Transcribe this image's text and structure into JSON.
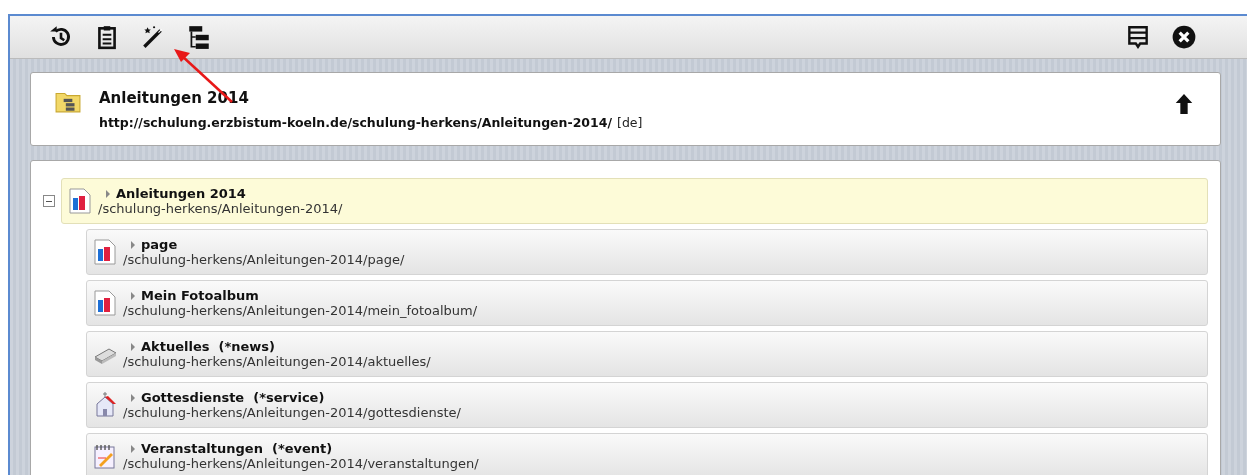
{
  "toolbar": {
    "left": [
      {
        "kind": "history"
      },
      {
        "kind": "clipboard"
      },
      {
        "kind": "wand"
      },
      {
        "kind": "tree"
      }
    ],
    "right": [
      {
        "kind": "list"
      },
      {
        "kind": "close"
      }
    ]
  },
  "header": {
    "title": "Anleitungen 2014",
    "url": "http://schulung.erzbistum-koeln.de/schulung-herkens/Anleitungen-2014/",
    "lang": "[de]"
  },
  "tree": {
    "name": "Anleitungen 2014",
    "path": "/schulung-herkens/Anleitungen-2014/",
    "kind": "page",
    "selected": true,
    "expanded": true,
    "children": [
      {
        "name": "page",
        "path": "/schulung-herkens/Anleitungen-2014/page/",
        "kind": "page",
        "selected": false
      },
      {
        "name": "Mein Fotoalbum",
        "path": "/schulung-herkens/Anleitungen-2014/mein_fotoalbum/",
        "kind": "page",
        "selected": false
      },
      {
        "name": "Aktuelles  (*news)",
        "path": "/schulung-herkens/Anleitungen-2014/aktuelles/",
        "kind": "news",
        "selected": false
      },
      {
        "name": "Gottesdienste  (*service)",
        "path": "/schulung-herkens/Anleitungen-2014/gottesdienste/",
        "kind": "service",
        "selected": false
      },
      {
        "name": "Veranstaltungen  (*event)",
        "path": "/schulung-herkens/Anleitungen-2014/veranstaltungen/",
        "kind": "event",
        "selected": false
      }
    ]
  }
}
